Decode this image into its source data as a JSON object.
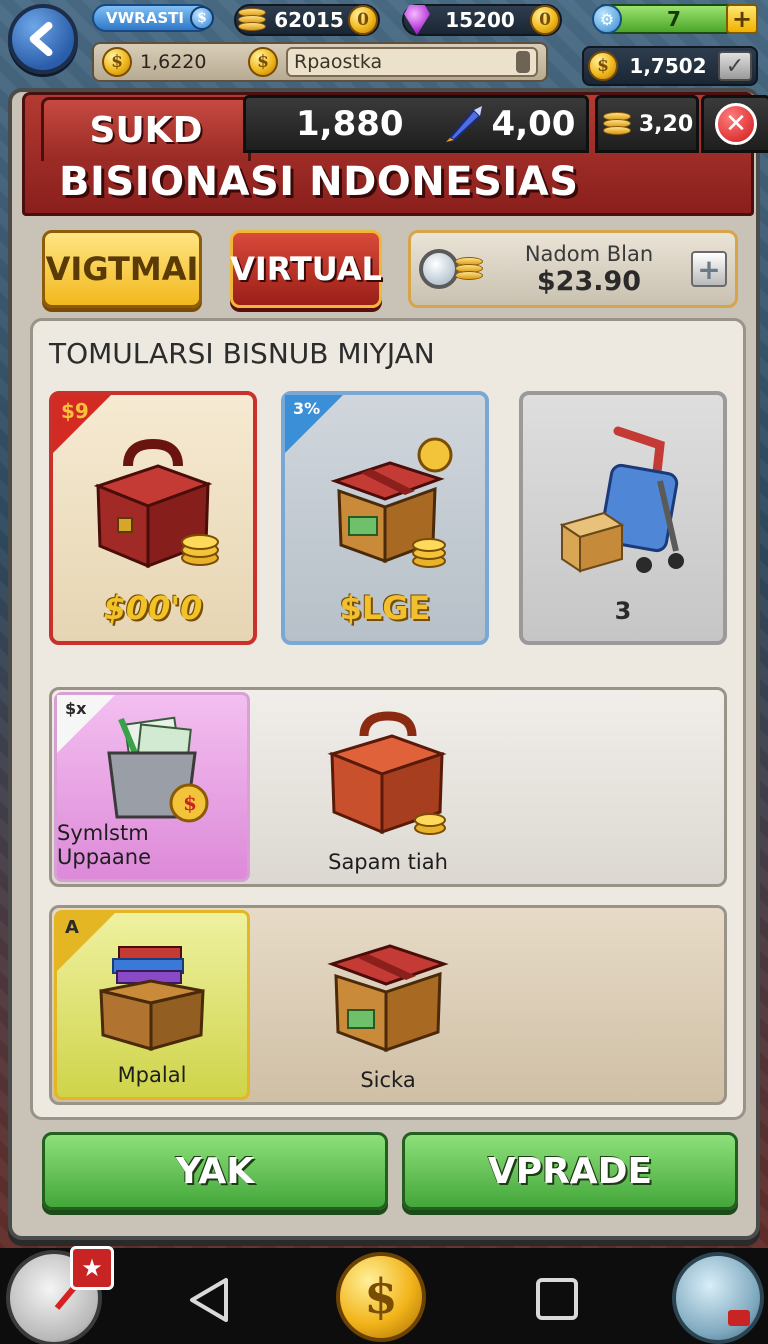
{
  "hud": {
    "badge_label": "VWRASTI",
    "coins_top": "62015",
    "gems": "15200",
    "level_bar_value": "7",
    "search_left_value": "1,6220",
    "search_text": "Rpaostka",
    "right_value": "1,7502"
  },
  "panel": {
    "tab_label": "SUKD",
    "stat_1": "1,880",
    "stat_2": "4,00",
    "coin_slot_value": "3,20",
    "title": "BISIONASI NDONESIAS"
  },
  "buttons": {
    "yellow": "VIGTMAI",
    "red": "VIRTUAL"
  },
  "balance": {
    "name": "Nadom Blan",
    "amount": "$23.90"
  },
  "section": {
    "title": "TOMULARSI BISNUB MIYJAN"
  },
  "cards": [
    {
      "tag": "$9",
      "label": "$00'0"
    },
    {
      "tag": "3%",
      "label": "$LGE"
    },
    {
      "tag": "",
      "label": "3"
    }
  ],
  "rows": [
    {
      "tag": "$x",
      "tile_label": "Symlstm Uppaane",
      "item_label": "Sapam tiah"
    },
    {
      "tag": "A",
      "tile_label": "Mpalal",
      "item_label": "Sicka"
    }
  ],
  "footer": {
    "left_button": "YAK",
    "right_button": "VPRADE"
  },
  "nav": {
    "home_symbol": "$"
  },
  "colors": {
    "panel_red": "#b33a33",
    "accent_gold": "#f2b81d",
    "button_green": "#43a73a"
  }
}
